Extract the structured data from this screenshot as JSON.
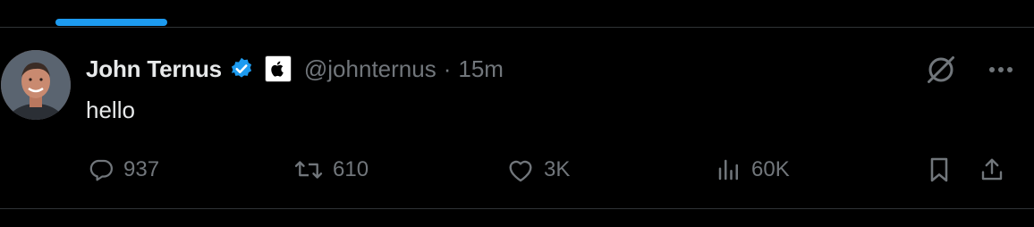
{
  "tab": {
    "indicator_color": "#1d9bf0"
  },
  "post": {
    "author": {
      "display_name": "John Ternus",
      "handle": "@johnternus",
      "verified_icon": "verified-badge-icon",
      "affiliate_icon": "apple-logo-icon"
    },
    "separator": "·",
    "time": "15m",
    "text": "hello",
    "header_icons": [
      "grok-icon",
      "more-icon"
    ],
    "metrics": {
      "replies": "937",
      "reposts": "610",
      "likes": "3K",
      "views": "60K"
    },
    "action_icons": [
      "reply-icon",
      "repost-icon",
      "like-icon",
      "views-icon",
      "bookmark-icon",
      "share-icon"
    ]
  },
  "colors": {
    "background": "#000000",
    "text_primary": "#e7e9ea",
    "text_secondary": "#71767b",
    "accent": "#1d9bf0",
    "divider": "#2f3336"
  }
}
